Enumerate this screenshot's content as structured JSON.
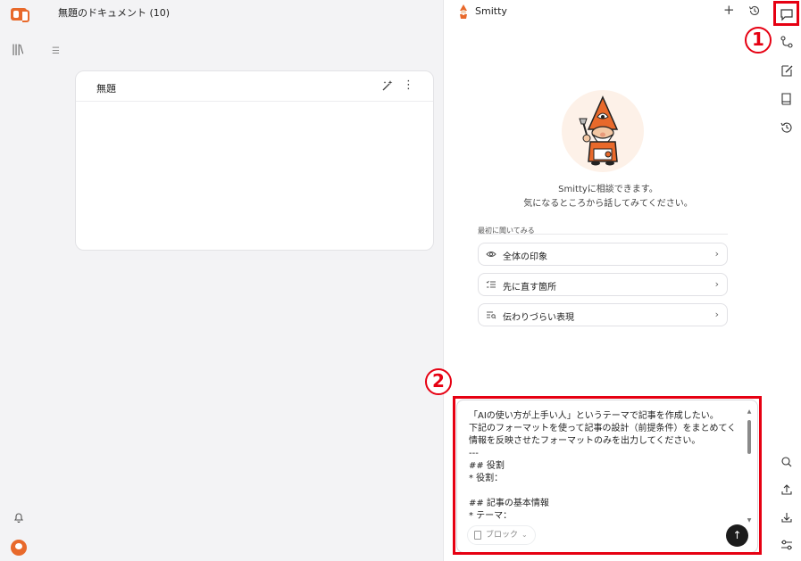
{
  "doc": {
    "window_title": "無題のドキュメント (10)",
    "card_title": "無題"
  },
  "chat": {
    "assistant_name": "Smitty",
    "intro_line1": "Smittyに相談できます。",
    "intro_line2": "気になるところから話してみてください。",
    "suggest_label": "最初に聞いてみる",
    "suggestions": [
      {
        "label": "全体の印象",
        "icon": "eye-icon"
      },
      {
        "label": "先に直す箇所",
        "icon": "checklist-icon"
      },
      {
        "label": "伝わりづらい表現",
        "icon": "text-search-icon"
      }
    ],
    "input_value": "「AIの使い方が上手い人」というテーマで記事を作成したい。\n下記のフォーマットを使って記事の設計（前提条件）をまとめてください。\n情報を反映させたフォーマットのみを出力してください。\n---\n## 役割\n* 役割：\n\n## 記事の基本情報\n* テーマ：",
    "mode_label": "ブロック"
  },
  "right_rail": {
    "icons": [
      "chat-icon",
      "route-icon",
      "edit-note-icon",
      "book-icon",
      "history-icon",
      "search-icon",
      "upload-icon",
      "download-icon",
      "settings-sliders-icon"
    ]
  },
  "annotations": {
    "marker1": "1",
    "marker2": "2",
    "color": "#e60012"
  },
  "colors": {
    "brand": "#e8692b",
    "send_button": "#1c1c1c"
  }
}
